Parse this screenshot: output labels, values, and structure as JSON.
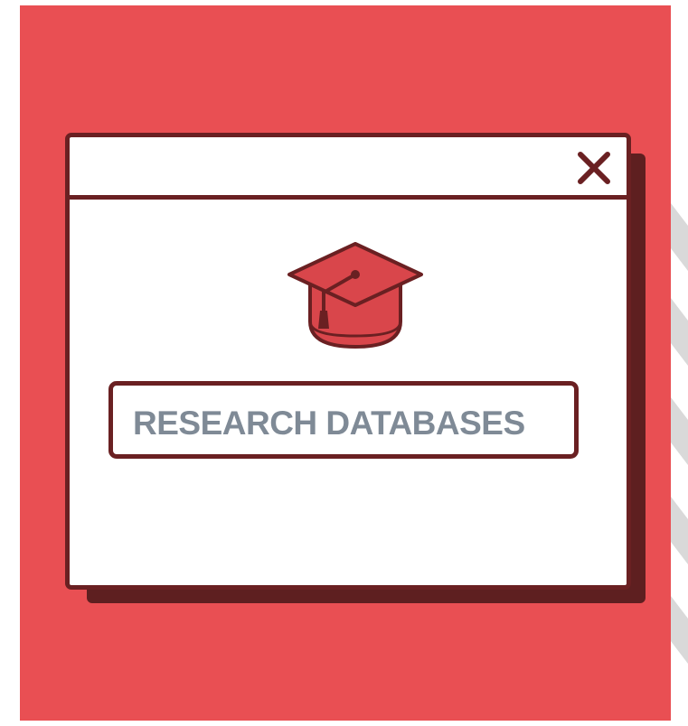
{
  "colors": {
    "background": "#e94f53",
    "outline": "#6a2022",
    "shadow": "#5e1f20",
    "cap": "#d9464b",
    "text": "#7f8a96"
  },
  "window": {
    "close_icon": "close-icon",
    "icon": "graduation-cap-icon"
  },
  "search": {
    "label": "RESEARCH DATABASES"
  }
}
